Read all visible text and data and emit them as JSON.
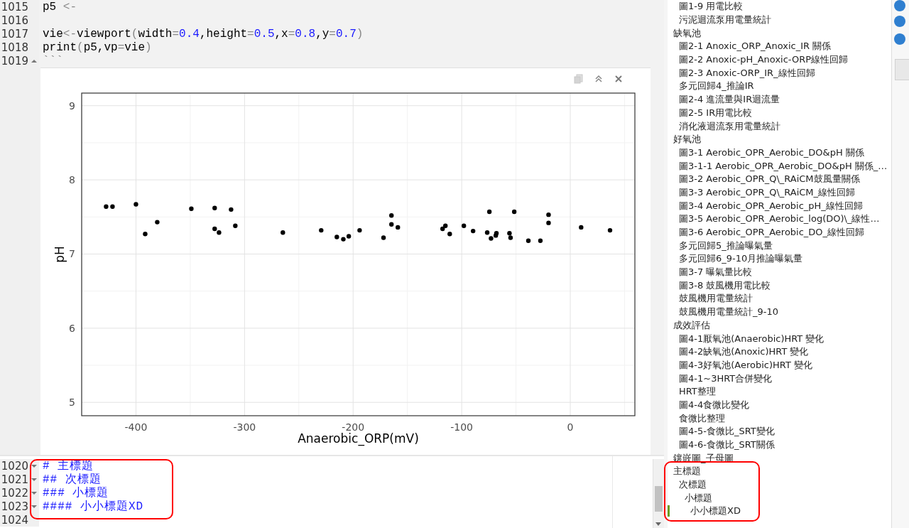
{
  "editor": {
    "top_lines": [
      {
        "number": "1015",
        "kind": "code",
        "tokens": [
          {
            "kind": "plain",
            "text": "p5 "
          },
          {
            "kind": "op",
            "text": "<-"
          }
        ]
      },
      {
        "number": "1016",
        "kind": "blank"
      },
      {
        "number": "1017",
        "kind": "code",
        "tokens": [
          {
            "kind": "plain",
            "text": "vie"
          },
          {
            "kind": "op",
            "text": "<-"
          },
          {
            "kind": "plain",
            "text": "viewport"
          },
          {
            "kind": "op",
            "text": "("
          },
          {
            "kind": "plain",
            "text": "width"
          },
          {
            "kind": "op",
            "text": "="
          },
          {
            "kind": "number",
            "text": "0.4"
          },
          {
            "kind": "plain",
            "text": ",height"
          },
          {
            "kind": "op",
            "text": "="
          },
          {
            "kind": "number",
            "text": "0.5"
          },
          {
            "kind": "plain",
            "text": ",x"
          },
          {
            "kind": "op",
            "text": "="
          },
          {
            "kind": "number",
            "text": "0.8"
          },
          {
            "kind": "plain",
            "text": ",y"
          },
          {
            "kind": "op",
            "text": "="
          },
          {
            "kind": "number",
            "text": "0.7"
          },
          {
            "kind": "op",
            "text": ")"
          }
        ]
      },
      {
        "number": "1018",
        "kind": "code",
        "tokens": [
          {
            "kind": "plain",
            "text": "print"
          },
          {
            "kind": "op",
            "text": "("
          },
          {
            "kind": "plain",
            "text": "p5,vp"
          },
          {
            "kind": "op",
            "text": "="
          },
          {
            "kind": "plain",
            "text": "vie"
          },
          {
            "kind": "op",
            "text": ")"
          }
        ]
      },
      {
        "number": "1019",
        "kind": "chunk-end",
        "tokens": [
          {
            "kind": "op",
            "text": "```"
          }
        ]
      }
    ],
    "chart_output": {
      "chart_data": {
        "type": "scatter",
        "grid": true,
        "xlabel": "Anaerobic_ORP(mV)",
        "ylabel": "pH",
        "x": [
          -427.5,
          -421.6,
          -400,
          -391.5,
          -380.4,
          -349,
          -327.5,
          -327.5,
          -323.5,
          -312.4,
          -308.5,
          -264.7,
          -229.4,
          -215,
          -209,
          -204,
          -194,
          -172,
          -164.7,
          -164.7,
          -158.8,
          -117.6,
          -115,
          -111,
          -98,
          -89.5,
          -76.5,
          -74.5,
          -73,
          -68.6,
          -68,
          -56,
          -55,
          -51.6,
          -38.6,
          -27.5,
          -20,
          -20,
          10,
          36.6
        ],
        "series": [
          {
            "color": "#000000",
            "values": [
              7.64,
              7.64,
              7.67,
              7.27,
              7.43,
              7.61,
              7.62,
              7.34,
              7.29,
              7.6,
              7.38,
              7.29,
              7.32,
              7.23,
              7.2,
              7.24,
              7.32,
              7.22,
              7.52,
              7.4,
              7.36,
              7.34,
              7.38,
              7.27,
              7.38,
              7.31,
              7.29,
              7.57,
              7.21,
              7.25,
              7.28,
              7.28,
              7.22,
              7.57,
              7.18,
              7.18,
              7.53,
              7.42,
              7.36,
              7.32
            ]
          }
        ],
        "xlim": [
          -450,
          59.5
        ],
        "ylim": [
          4.82,
          9.17
        ],
        "xticks": [
          -400,
          -300,
          -200,
          -100,
          0
        ],
        "yticks": [
          5,
          6,
          7,
          8,
          9
        ]
      }
    },
    "bottom_lines": [
      {
        "number": "1020",
        "kind": "section",
        "tokens": [
          {
            "kind": "heading",
            "text": "# 主標題"
          }
        ]
      },
      {
        "number": "1021",
        "kind": "section",
        "tokens": [
          {
            "kind": "heading",
            "text": "## 次標題"
          }
        ]
      },
      {
        "number": "1022",
        "kind": "section",
        "tokens": [
          {
            "kind": "heading",
            "text": "### 小標題"
          }
        ]
      },
      {
        "number": "1023",
        "kind": "section",
        "tokens": [
          {
            "kind": "heading",
            "text": "#### 小小標題XD"
          }
        ]
      },
      {
        "number": "1024",
        "kind": "blank"
      }
    ]
  },
  "outline": {
    "leading_items": [
      {
        "label": "圖1-9 用電比較",
        "current": false
      },
      {
        "label": "污泥迴流泵用電量統計",
        "current": false
      }
    ],
    "items": [
      {
        "label": "缺氧池",
        "current": false,
        "children": [
          {
            "label": "圖2-1 Anoxic_ORP_Anoxic_IR 關係",
            "current": false
          },
          {
            "label": "圖2-2 Anoxic-pH_Anoxic-ORP線性回歸",
            "current": false
          },
          {
            "label": "圖2-3 Anoxic-ORP_IR_線性回歸",
            "current": false
          },
          {
            "label": "多元回歸4_推論IR",
            "current": false
          },
          {
            "label": "圖2-4 進流量與IR迴流量",
            "current": false
          },
          {
            "label": "圖2-5 IR用電比較",
            "current": false
          },
          {
            "label": "消化液迴流泵用電量統計",
            "current": false
          }
        ]
      },
      {
        "label": "好氧池",
        "current": false,
        "children": [
          {
            "label": "圖3-1 Aerobic_OPR_Aerobic_DO&pH 關係",
            "current": false
          },
          {
            "label": "圖3-1-1 Aerobic_OPR_Aerobic_DO&pH 關係_…",
            "current": false
          },
          {
            "label": "圖3-2 Aerobic_OPR_Q\\_RAiCM鼓風量關係",
            "current": false
          },
          {
            "label": "圖3-3 Aerobic_OPR_Q\\_RAiCM_線性回歸",
            "current": false
          },
          {
            "label": "圖3-4 Aerobic_OPR_Aerobic_pH_線性回歸",
            "current": false
          },
          {
            "label": "圖3-5 Aerobic_OPR_Aerobic_log(DO)\\_線性…",
            "current": false
          },
          {
            "label": "圖3-6 Aerobic_OPR_Aerobic_DO_線性回歸",
            "current": false
          },
          {
            "label": "多元回歸5_推論曝氣量",
            "current": false
          },
          {
            "label": "多元回歸6_9-10月推論曝氣量",
            "current": false
          },
          {
            "label": "圖3-7 曝氣量比較",
            "current": false
          },
          {
            "label": "圖3-8 鼓風機用電比較",
            "current": false
          },
          {
            "label": "鼓風機用電量統計",
            "current": false
          },
          {
            "label": "鼓風機用電量統計_9-10",
            "current": false
          }
        ]
      },
      {
        "label": "成效評估",
        "current": false,
        "children": [
          {
            "label": "圖4-1厭氧池(Anaerobic)HRT 變化",
            "current": false
          },
          {
            "label": "圖4-2缺氧池(Anoxic)HRT 變化",
            "current": false
          },
          {
            "label": "圖4-3好氧池(Aerobic)HRT 變化",
            "current": false
          },
          {
            "label": "圖4-1~3HRT合併變化",
            "current": false
          },
          {
            "label": "HRT整理",
            "current": false
          },
          {
            "label": "圖4-4食微比變化",
            "current": false
          },
          {
            "label": "食微比整理",
            "current": false
          },
          {
            "label": "圖4-5-食微比_SRT變化",
            "current": false
          },
          {
            "label": "圖4-6-食微比_SRT關係",
            "current": false
          }
        ]
      },
      {
        "label": "鑲嵌圖_子母圖",
        "current": false
      },
      {
        "label": "主標題",
        "current": false,
        "children": [
          {
            "label": "次標題",
            "current": false,
            "children": [
              {
                "label": "小標題",
                "current": false,
                "children": [
                  {
                    "label": "小小標題XD",
                    "current": true
                  }
                ]
              }
            ]
          }
        ]
      }
    ]
  }
}
